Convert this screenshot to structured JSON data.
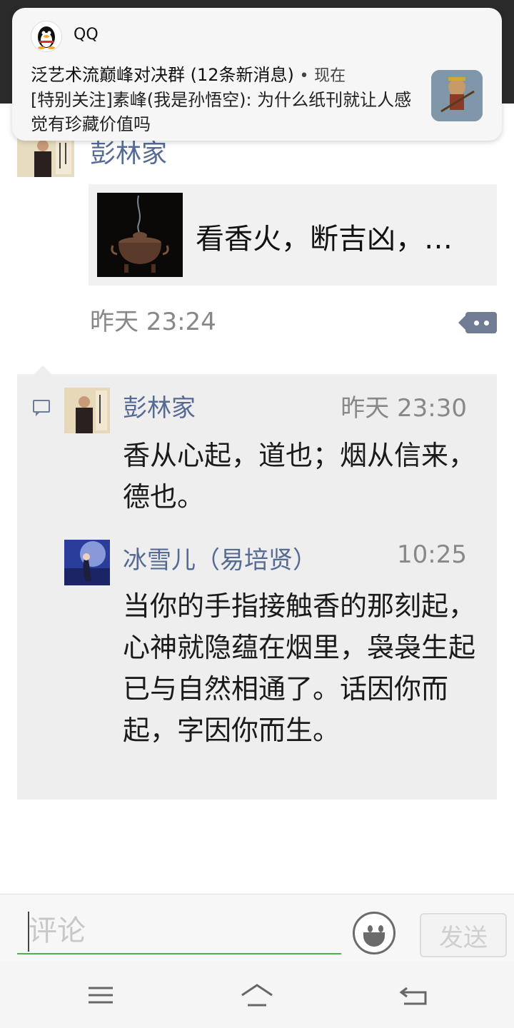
{
  "notification": {
    "app_name": "QQ",
    "group_title": "泛艺术流巅峰对决群 (12条新消息)",
    "separator": "•",
    "time": "现在",
    "message": "[特别关注]素峰(我是孙悟空): 为什么纸刊就让人感觉有珍藏价值吗",
    "app_icon": "qq-penguin-icon"
  },
  "post": {
    "author": "彭林家",
    "link_title": "看香火，断吉凶，…",
    "time": "昨天 23:24",
    "more_icon": "more-options-icon"
  },
  "comments": [
    {
      "name": "彭林家",
      "time": "昨天 23:30",
      "text": "香从心起，道也；烟从信来，德也。"
    },
    {
      "name": "冰雪儿（易培贤）",
      "time": "10:25",
      "text": "当你的手指接触香的那刻起，心神就隐蕴在烟里，袅袅生起已与自然相通了。话因你而起，字因你而生。"
    }
  ],
  "input": {
    "placeholder": "评论",
    "value": "",
    "send_label": "发送"
  },
  "nav": {
    "icons": [
      "menu-icon",
      "home-icon",
      "back-icon"
    ]
  },
  "colors": {
    "name_link": "#566b94",
    "input_underline": "#4caf50",
    "comment_bg": "#eeeeee"
  }
}
